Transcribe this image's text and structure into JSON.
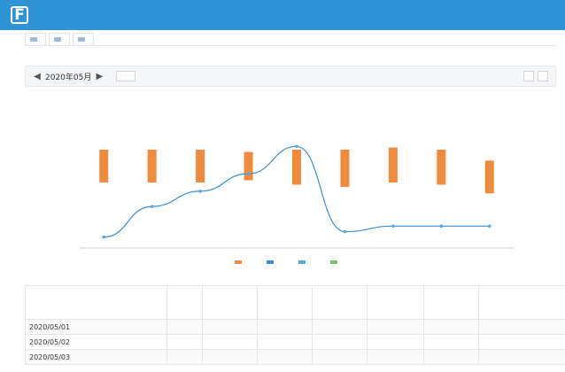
{
  "header": {
    "title": ""
  },
  "tabs": [
    {
      "label": "",
      "active": false
    },
    {
      "label": "",
      "active": true
    },
    {
      "label": "",
      "active": false
    }
  ],
  "toolbar": {
    "date_label": "2020年05月"
  },
  "colors": {
    "header": "#2f94d6",
    "bar": "#f08a3c",
    "line_a": "#3d8fd1",
    "line_b": "#5aaae0",
    "accent": "#7cc36e"
  },
  "chart_data": {
    "type": "bar",
    "title": "",
    "xlabel": "",
    "ylabel": "",
    "categories": [
      "",
      "",
      "",
      "",
      "",
      "",
      "",
      "",
      ""
    ],
    "series": [
      {
        "name": "",
        "type": "range-bar",
        "low": [
          100,
          100,
          100,
          102,
          98,
          96,
          100,
          98,
          90
        ],
        "high": [
          130,
          130,
          130,
          128,
          130,
          130,
          132,
          130,
          120
        ]
      },
      {
        "name": "",
        "type": "line",
        "values": [
          50,
          78,
          92,
          108,
          133,
          55,
          60,
          60,
          60
        ]
      }
    ],
    "ylim": [
      40,
      160
    ],
    "legend": "bottom",
    "grid": false
  },
  "table": {
    "columns": [
      "",
      "",
      "",
      "",
      "",
      "",
      "",
      ""
    ],
    "rows": [
      [
        "2020/05/01",
        "",
        "",
        "",
        "",
        "",
        "",
        ""
      ],
      [
        "2020/05/02",
        "",
        "",
        "",
        "",
        "",
        "",
        ""
      ],
      [
        "2020/05/03",
        "",
        "",
        "",
        "",
        "",
        "",
        ""
      ]
    ]
  }
}
